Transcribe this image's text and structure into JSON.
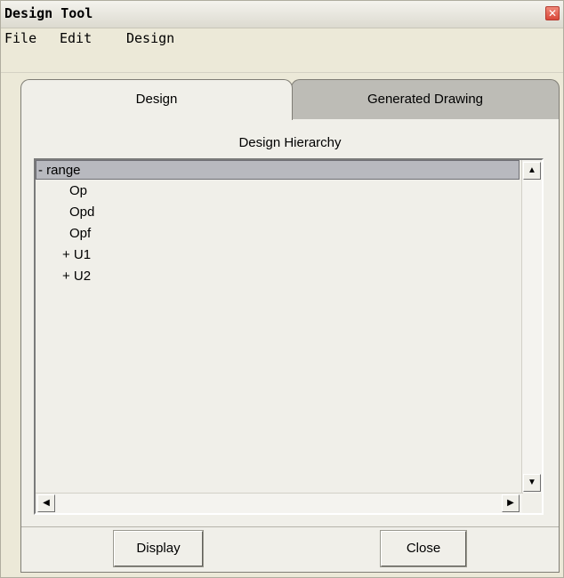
{
  "window": {
    "title": "Design Tool",
    "close_glyph": "✕"
  },
  "menu": [
    "File",
    "Edit",
    "Design"
  ],
  "tabs": [
    {
      "label": "Design",
      "active": true
    },
    {
      "label": "Generated Drawing",
      "active": false
    }
  ],
  "section_title": "Design Hierarchy",
  "tree": [
    {
      "label": "- range",
      "indent": 0,
      "selected": true
    },
    {
      "label": "Op",
      "indent": 2,
      "selected": false
    },
    {
      "label": "Opd",
      "indent": 2,
      "selected": false
    },
    {
      "label": "Opf",
      "indent": 2,
      "selected": false
    },
    {
      "label": "+ U1",
      "indent": 1,
      "selected": false
    },
    {
      "label": "+ U2",
      "indent": 1,
      "selected": false
    }
  ],
  "buttons": {
    "display": "Display",
    "close": "Close"
  },
  "icons": {
    "scroll_up": "▲",
    "scroll_down": "▼",
    "scroll_left": "◀",
    "scroll_right": "▶"
  },
  "colors": {
    "selection": "#b8b9bf",
    "inactive_tab": "#bdbcb6",
    "close_button": "#d9483a"
  }
}
